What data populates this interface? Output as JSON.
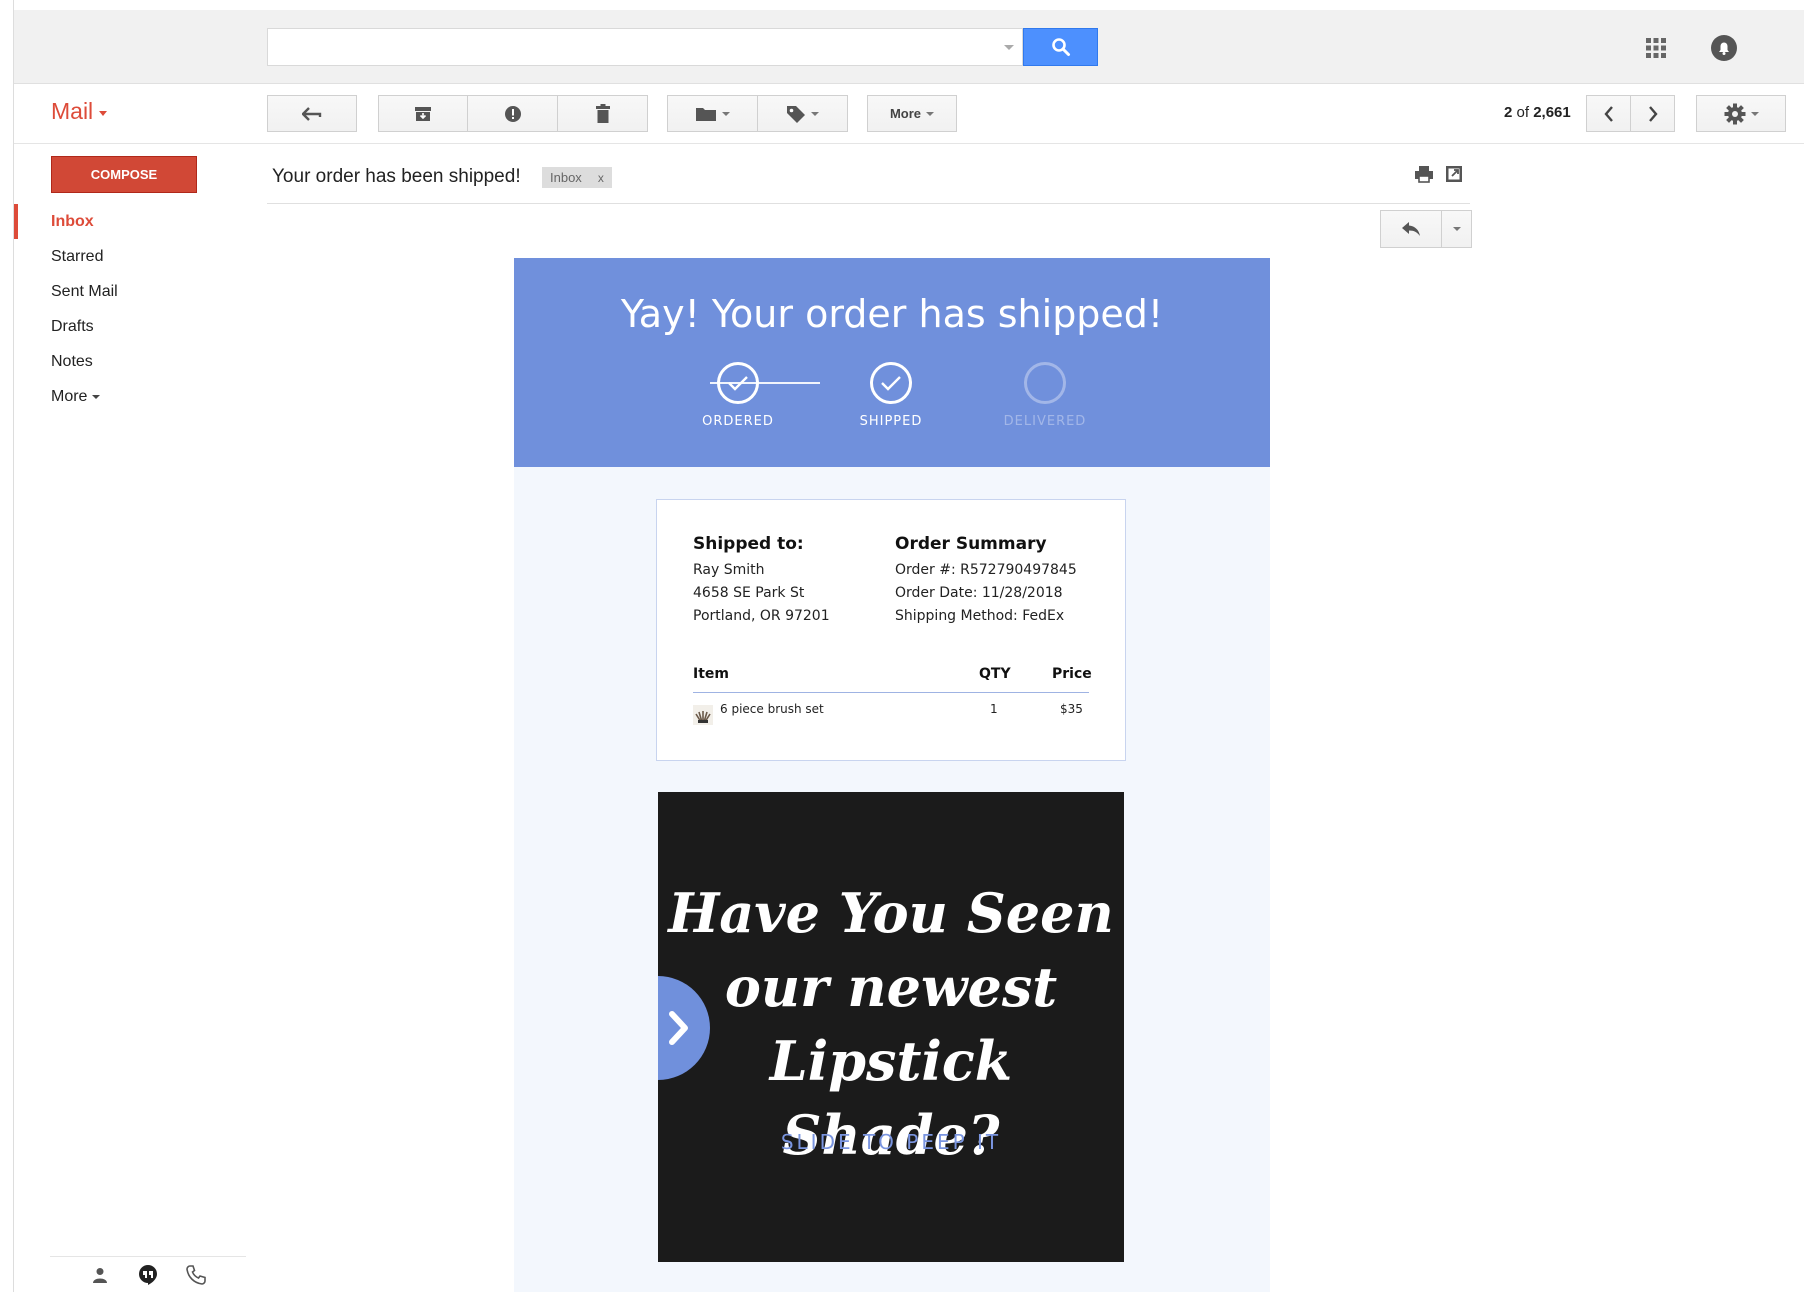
{
  "search": {
    "value": "",
    "placeholder": ""
  },
  "header": {
    "app_label": "Mail"
  },
  "toolbar": {
    "more_label": "More",
    "pager_current": "2",
    "pager_of": "of",
    "pager_total": "2,661"
  },
  "sidebar": {
    "compose_label": "COMPOSE",
    "items": [
      {
        "label": "Inbox",
        "active": true
      },
      {
        "label": "Starred"
      },
      {
        "label": "Sent Mail"
      },
      {
        "label": "Drafts"
      },
      {
        "label": "Notes"
      },
      {
        "label": "More"
      }
    ]
  },
  "message": {
    "subject": "Your order has been shipped!",
    "label_chip": "Inbox",
    "label_chip_remove": "x"
  },
  "email": {
    "hero_title": "Yay! Your order has shipped!",
    "steps": [
      {
        "label": "ORDERED",
        "complete": true
      },
      {
        "label": "SHIPPED",
        "complete": true
      },
      {
        "label": "DELIVERED",
        "complete": false
      }
    ],
    "shipped_to": {
      "heading": "Shipped to:",
      "name": "Ray Smith",
      "street": "4658 SE Park St",
      "city": "Portland, OR 97201"
    },
    "order_summary": {
      "heading": "Order Summary",
      "order_number": "Order #: R572790497845",
      "order_date": "Order Date: 11/28/2018",
      "shipping_method": "Shipping Method: FedEx"
    },
    "items_table": {
      "headers": {
        "item": "Item",
        "qty": "QTY",
        "price": "Price"
      },
      "rows": [
        {
          "item": "6 piece brush set",
          "qty": "1",
          "price": "$35"
        }
      ]
    },
    "promo": {
      "line1": "Have You Seen",
      "line2": "our newest",
      "line3": "Lipstick Shade?",
      "cta": "SLIDE TO PEEP IT"
    }
  },
  "colors": {
    "gmail_red": "#dd4b39",
    "compose_red": "#d14836",
    "search_blue": "#4d90fe",
    "hero_blue": "#7090dc",
    "email_bg": "#f3f7fd",
    "promo_bg": "#1b1b1b"
  },
  "icons": {
    "search": "search-icon",
    "apps": "apps-grid-icon",
    "notifications": "notifications-icon",
    "back": "back-arrow-icon",
    "archive": "archive-icon",
    "spam": "report-spam-icon",
    "delete": "trash-icon",
    "move": "folder-icon",
    "labels": "label-tag-icon",
    "prev": "chevron-left-icon",
    "next": "chevron-right-icon",
    "settings": "gear-icon",
    "print": "print-icon",
    "new_window": "new-window-icon",
    "reply": "reply-icon",
    "contacts": "person-icon",
    "hangouts": "hangouts-icon",
    "phone": "phone-icon"
  }
}
